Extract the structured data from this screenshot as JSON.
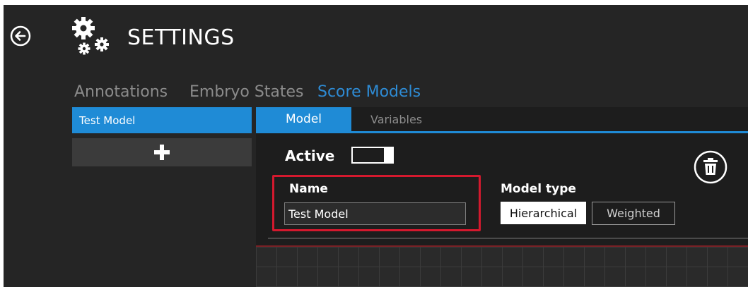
{
  "header": {
    "title": "SETTINGS",
    "back_icon": "back-arrow-icon",
    "settings_icon": "gears-icon"
  },
  "categories": [
    {
      "label": "Annotations",
      "selected": false
    },
    {
      "label": "Embryo States",
      "selected": false
    },
    {
      "label": "Score Models",
      "selected": true
    }
  ],
  "models": {
    "items": [
      {
        "label": "Test Model",
        "selected": true
      }
    ],
    "add_icon": "plus-icon"
  },
  "detail": {
    "tabs": [
      {
        "label": "Model",
        "selected": true
      },
      {
        "label": "Variables",
        "selected": false
      }
    ],
    "active_label": "Active",
    "active_on": true,
    "name_label": "Name",
    "name_value": "Test Model",
    "model_type_label": "Model type",
    "model_types": [
      {
        "label": "Hierarchical",
        "selected": true
      },
      {
        "label": "Weighted",
        "selected": false
      }
    ],
    "delete_icon": "trash-icon"
  },
  "colors": {
    "accent": "#1f8bd6",
    "background": "#252525",
    "highlight": "#d4192e"
  }
}
